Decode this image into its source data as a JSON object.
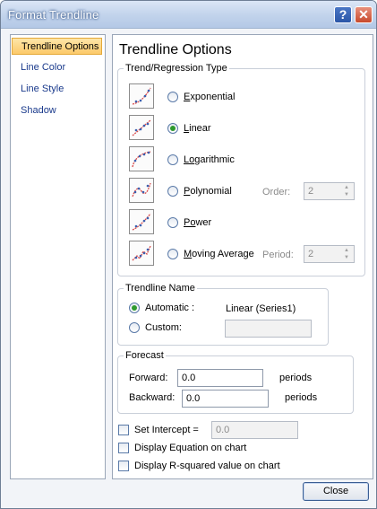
{
  "window": {
    "title": "Format Trendline"
  },
  "nav": {
    "items": [
      {
        "label": "Trendline Options",
        "selected": true
      },
      {
        "label": "Line Color",
        "selected": false
      },
      {
        "label": "Line Style",
        "selected": false
      },
      {
        "label": "Shadow",
        "selected": false
      }
    ]
  },
  "main": {
    "heading": "Trendline Options"
  },
  "type_group": {
    "label": "Trend/Regression Type",
    "options": [
      {
        "key": "E",
        "rest": "xponential",
        "selected": false,
        "icon": "exponential-trend-icon"
      },
      {
        "key": "L",
        "rest": "inear",
        "selected": true,
        "icon": "linear-trend-icon"
      },
      {
        "key": "Lo",
        "rest": "garithmic",
        "selected": false,
        "icon": "logarithmic-trend-icon"
      },
      {
        "key": "P",
        "rest": "olynomial",
        "selected": false,
        "icon": "polynomial-trend-icon"
      },
      {
        "key": "Po",
        "rest": "wer",
        "selected": false,
        "icon": "power-trend-icon"
      },
      {
        "key": "M",
        "rest": "oving Average",
        "selected": false,
        "icon": "moving-average-trend-icon"
      }
    ],
    "order_label": "Order:",
    "order_value": "2",
    "period_label": "Period:",
    "period_value": "2"
  },
  "name_group": {
    "label": "Trendline Name",
    "automatic_label": "Automatic :",
    "automatic_value": "Linear (Series1)",
    "custom_label": "Custom:",
    "custom_value": ""
  },
  "forecast_group": {
    "label": "Forecast",
    "forward_label": "Forward:",
    "forward_value": "0.0",
    "backward_label": "Backward:",
    "backward_value": "0.0",
    "units": "periods"
  },
  "options": {
    "set_intercept_label": "Set Intercept =",
    "set_intercept_value": "0.0",
    "display_equation_label": "Display Equation on chart",
    "display_rsquared_label": "Display R-squared value on chart"
  },
  "footer": {
    "close_label": "Close"
  },
  "colors": {
    "accent": "#fcc96a",
    "link": "#1a3a8c",
    "radio_on": "#2e9a2e"
  }
}
